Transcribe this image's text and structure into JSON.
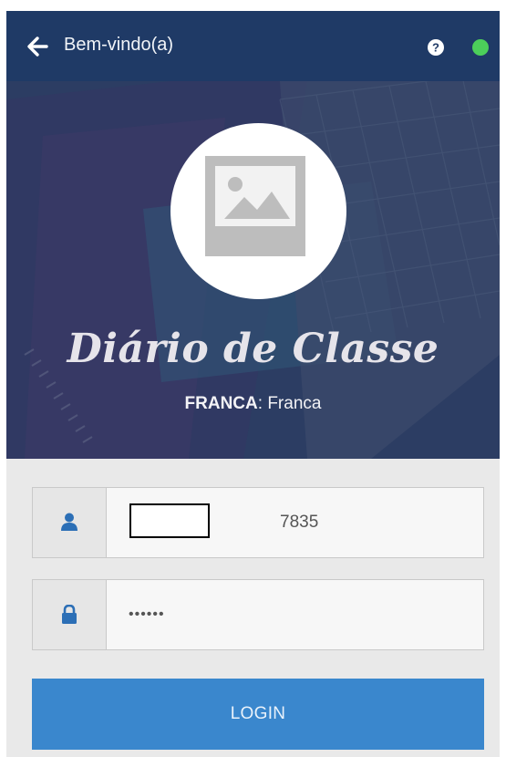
{
  "topbar": {
    "title": "Bem-vindo(a)",
    "status_color": "#4ccf5a",
    "bar_color": "#1f3a66"
  },
  "hero": {
    "app_name": "Diário de Classe",
    "school_code": "FRANCA",
    "school_separator": ": ",
    "school_name": "Franca"
  },
  "form": {
    "username_value": "7835",
    "password_value": "••••••",
    "login_label": "LOGIN",
    "accent_color": "#3a87cd"
  },
  "icons": [
    "back-arrow-icon",
    "help-icon",
    "status-dot",
    "image-placeholder-icon",
    "user-icon",
    "lock-icon"
  ]
}
